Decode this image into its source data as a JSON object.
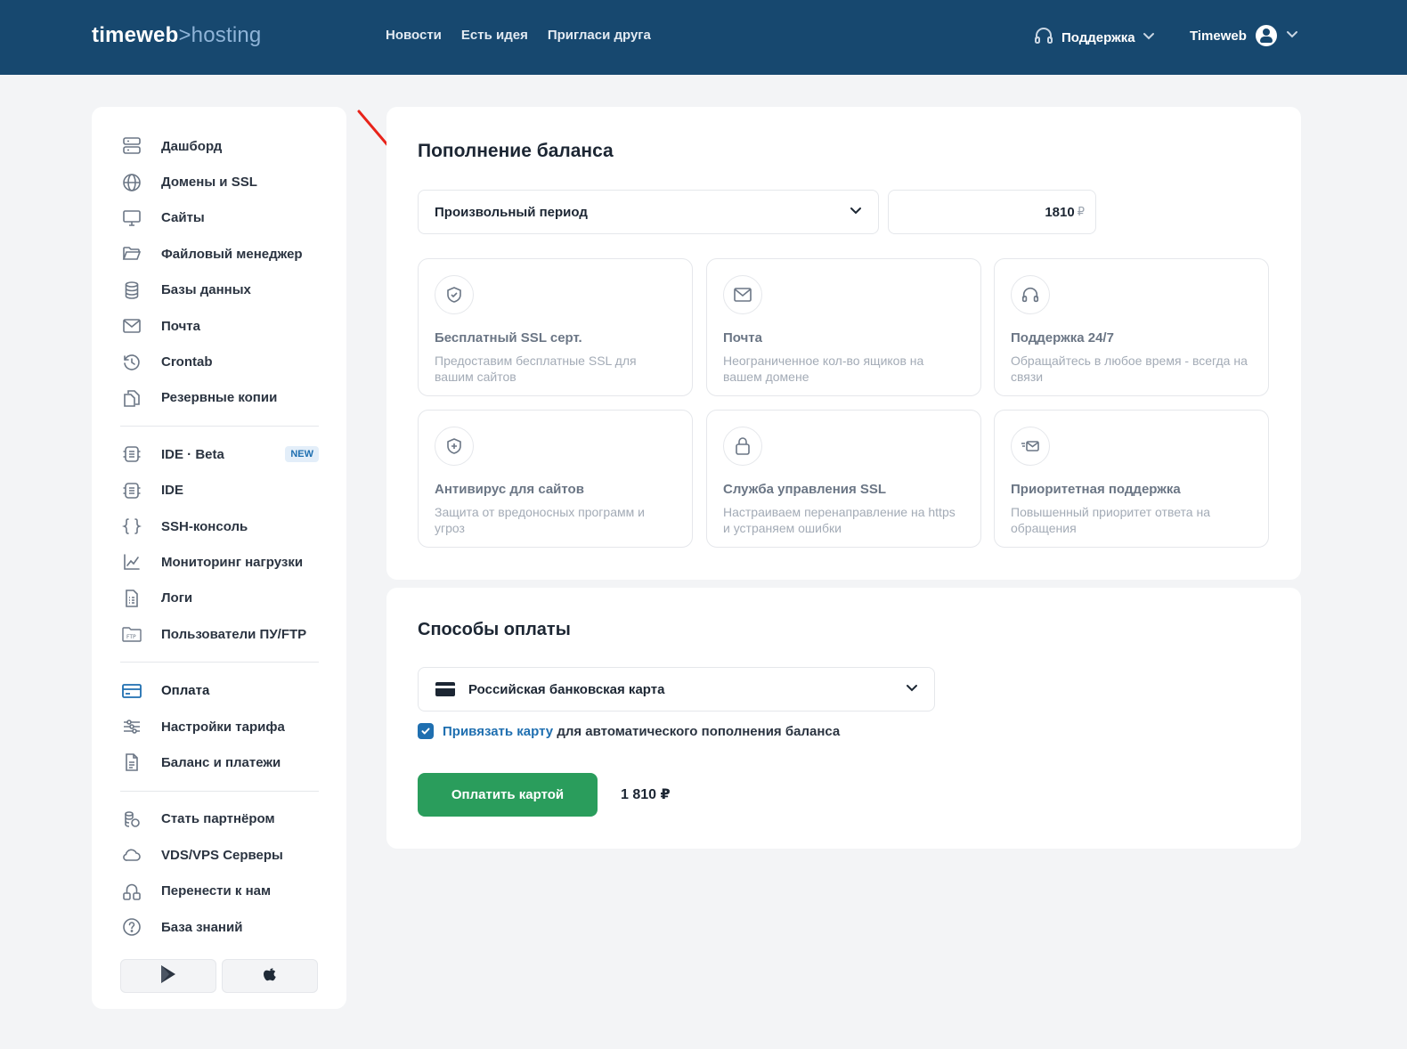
{
  "header": {
    "logo_brand": "timeweb",
    "logo_sep": ">",
    "logo_product": "hosting",
    "nav": [
      "Новости",
      "Есть идея",
      "Пригласи друга"
    ],
    "support_label": "Поддержка",
    "account_label": "Timeweb"
  },
  "sidebar": {
    "group1": [
      "Дашборд",
      "Домены и SSL",
      "Сайты",
      "Файловый менеджер",
      "Базы данных",
      "Почта",
      "Crontab",
      "Резервные копии"
    ],
    "group2": [
      "IDE · Beta",
      "IDE",
      "SSH-консоль",
      "Мониторинг нагрузки",
      "Логи",
      "Пользователи ПУ/FTP"
    ],
    "new_badge": "NEW",
    "group3": [
      "Оплата",
      "Настройки тарифа",
      "Баланс и платежи"
    ],
    "group4": [
      "Стать партнёром",
      "VDS/VPS Серверы",
      "Перенести к нам",
      "База знаний"
    ]
  },
  "balance": {
    "title": "Пополнение баланса",
    "period_selected": "Произвольный период",
    "amount": "1810",
    "currency": "₽",
    "features": [
      {
        "icon": "shield-check-icon",
        "title": "Бесплатный SSL серт.",
        "desc": "Предоставим бесплатные SSL для вашим сайтов"
      },
      {
        "icon": "mail-icon",
        "title": "Почта",
        "desc": "Неограниченное кол-во ящиков на вашем домене"
      },
      {
        "icon": "headphones-icon",
        "title": "Поддержка 24/7",
        "desc": "Обращайтесь в любое время - всегда на связи"
      },
      {
        "icon": "shield-plus-icon",
        "title": "Антивирус для сайтов",
        "desc": "Защита от вредоносных программ и угроз"
      },
      {
        "icon": "lock-icon",
        "title": "Служба управления SSL",
        "desc": "Настраиваем перенаправление на https и устраняем ошибки"
      },
      {
        "icon": "fast-mail-icon",
        "title": "Приоритетная поддержка",
        "desc": "Повышенный приоритет ответа на обращения"
      }
    ]
  },
  "payment": {
    "title": "Способы оплаты",
    "method_selected": "Российская банковская карта",
    "bind_link": "Привязать карту",
    "bind_rest": "для автоматического пополнения баланса",
    "bind_checked": true,
    "pay_button": "Оплатить картой",
    "total": "1 810 ₽"
  },
  "colors": {
    "header_bg": "#17486f",
    "accent": "#1f6fb0",
    "pay_button": "#2a9d5c",
    "annotation_arrow": "#e8231a"
  }
}
